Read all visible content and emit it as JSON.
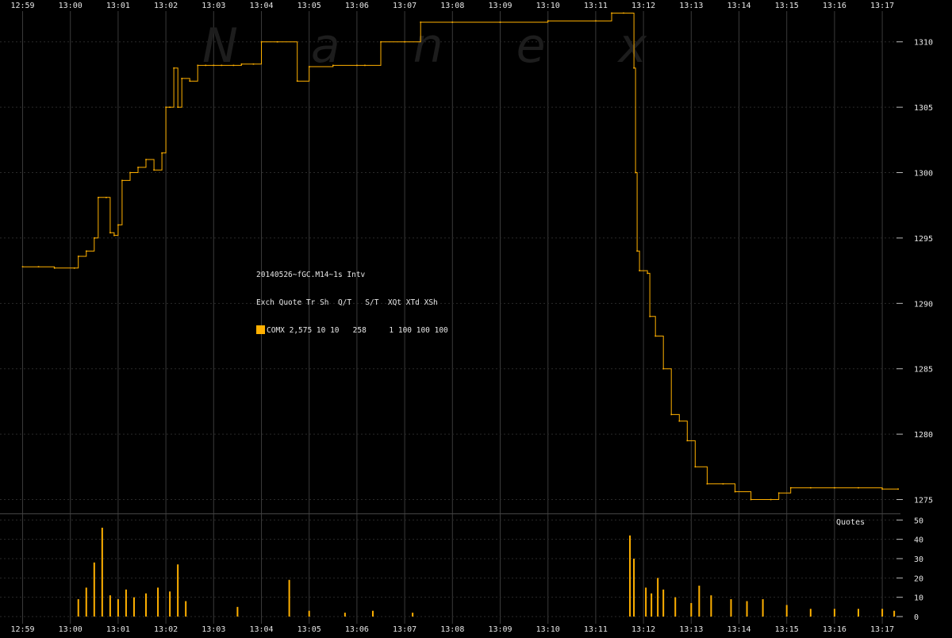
{
  "watermark": "N a n e x",
  "legend": {
    "title": "20140526~fGC.M14~1s Intv",
    "header": "Exch Quote Tr Sh  Q/T   S/T  XQt XTd XSh",
    "row": "COMX 2,575 10 10   258     1 100 100 100",
    "swatch_color": "#ffb000"
  },
  "volume_label": "Quotes",
  "colors": {
    "background": "#000000",
    "price": "#ffb000",
    "volume": "#ffb000",
    "grid": "#333333",
    "text": "#e6e6e6"
  },
  "chart_data": [
    {
      "type": "line",
      "title": "",
      "xlabel": "",
      "ylabel": "",
      "x_ticks": [
        "12:59",
        "13:00",
        "13:01",
        "13:02",
        "13:03",
        "13:04",
        "13:05",
        "13:06",
        "13:07",
        "13:08",
        "13:09",
        "13:10",
        "13:11",
        "13:12",
        "13:13",
        "13:14",
        "13:15",
        "13:16",
        "13:17"
      ],
      "xlim_minutes_after_1259": [
        -0.05,
        18.35
      ],
      "y_ticks": [
        1275,
        1280,
        1285,
        1290,
        1295,
        1300,
        1305,
        1310
      ],
      "ylim": [
        1274,
        1311.5
      ],
      "grid": true,
      "series": [
        {
          "points": [
            [
              "12:59:00",
              1292.8
            ],
            [
              "12:59:20",
              1292.8
            ],
            [
              "12:59:40",
              1292.7
            ],
            [
              "13:00:05",
              1292.7
            ],
            [
              "13:00:10",
              1293.6
            ],
            [
              "13:00:20",
              1294.0
            ],
            [
              "13:00:30",
              1295.0
            ],
            [
              "13:00:35",
              1298.1
            ],
            [
              "13:00:45",
              1298.1
            ],
            [
              "13:00:50",
              1295.4
            ],
            [
              "13:00:55",
              1295.2
            ],
            [
              "13:01:00",
              1296.0
            ],
            [
              "13:01:05",
              1299.4
            ],
            [
              "13:01:15",
              1300.0
            ],
            [
              "13:01:25",
              1300.4
            ],
            [
              "13:01:35",
              1301.0
            ],
            [
              "13:01:45",
              1300.2
            ],
            [
              "13:01:55",
              1301.5
            ],
            [
              "13:02:00",
              1305.0
            ],
            [
              "13:02:05",
              1305.0
            ],
            [
              "13:02:10",
              1308.0
            ],
            [
              "13:02:15",
              1305.0
            ],
            [
              "13:02:20",
              1307.2
            ],
            [
              "13:02:30",
              1307.0
            ],
            [
              "13:02:40",
              1308.2
            ],
            [
              "13:02:50",
              1308.2
            ],
            [
              "13:03:00",
              1308.2
            ],
            [
              "13:03:10",
              1308.2
            ],
            [
              "13:03:25",
              1308.2
            ],
            [
              "13:03:35",
              1308.3
            ],
            [
              "13:03:50",
              1308.3
            ],
            [
              "13:04:00",
              1310.0
            ],
            [
              "13:04:20",
              1310.0
            ],
            [
              "13:04:45",
              1307.0
            ],
            [
              "13:05:00",
              1308.1
            ],
            [
              "13:05:30",
              1308.2
            ],
            [
              "13:06:00",
              1308.2
            ],
            [
              "13:06:10",
              1308.2
            ],
            [
              "13:06:30",
              1310.0
            ],
            [
              "13:07:00",
              1310.0
            ],
            [
              "13:07:20",
              1311.5
            ],
            [
              "13:08:00",
              1311.5
            ],
            [
              "13:09:00",
              1311.5
            ],
            [
              "13:10:00",
              1311.6
            ],
            [
              "13:11:00",
              1311.6
            ],
            [
              "13:11:20",
              1312.2
            ],
            [
              "13:11:35",
              1312.2
            ],
            [
              "13:11:48",
              1308.0
            ],
            [
              "13:11:50",
              1300.0
            ],
            [
              "13:11:52",
              1294.0
            ],
            [
              "13:11:55",
              1292.5
            ],
            [
              "13:12:05",
              1292.3
            ],
            [
              "13:12:08",
              1289.0
            ],
            [
              "13:12:15",
              1287.5
            ],
            [
              "13:12:25",
              1285.0
            ],
            [
              "13:12:35",
              1281.5
            ],
            [
              "13:12:45",
              1281.0
            ],
            [
              "13:12:55",
              1279.5
            ],
            [
              "13:13:05",
              1277.5
            ],
            [
              "13:13:20",
              1276.2
            ],
            [
              "13:13:40",
              1276.2
            ],
            [
              "13:13:55",
              1275.6
            ],
            [
              "13:14:15",
              1275.0
            ],
            [
              "13:14:40",
              1275.0
            ],
            [
              "13:14:50",
              1275.5
            ],
            [
              "13:15:05",
              1275.9
            ],
            [
              "13:15:30",
              1275.9
            ],
            [
              "13:16:00",
              1275.9
            ],
            [
              "13:16:30",
              1275.9
            ],
            [
              "13:17:00",
              1275.8
            ],
            [
              "13:17:20",
              1275.8
            ]
          ]
        }
      ]
    },
    {
      "type": "bar",
      "title": "",
      "ylabel": "",
      "y_ticks": [
        0,
        10,
        20,
        30,
        40,
        50
      ],
      "ylim": [
        0,
        53
      ],
      "bar_width_seconds": 1,
      "bars": [
        [
          "13:00:10",
          9
        ],
        [
          "13:00:20",
          15
        ],
        [
          "13:00:30",
          28
        ],
        [
          "13:00:40",
          46
        ],
        [
          "13:00:50",
          11
        ],
        [
          "13:01:00",
          9
        ],
        [
          "13:01:10",
          14
        ],
        [
          "13:01:20",
          10
        ],
        [
          "13:01:35",
          12
        ],
        [
          "13:01:50",
          15
        ],
        [
          "13:02:05",
          13
        ],
        [
          "13:02:15",
          27
        ],
        [
          "13:02:25",
          8
        ],
        [
          "13:03:30",
          5
        ],
        [
          "13:04:35",
          19
        ],
        [
          "13:05:00",
          3
        ],
        [
          "13:05:45",
          2
        ],
        [
          "13:06:20",
          3
        ],
        [
          "13:07:10",
          2
        ],
        [
          "13:11:43",
          42
        ],
        [
          "13:11:48",
          30
        ],
        [
          "13:12:03",
          15
        ],
        [
          "13:12:10",
          12
        ],
        [
          "13:12:18",
          20
        ],
        [
          "13:12:25",
          14
        ],
        [
          "13:12:40",
          10
        ],
        [
          "13:13:00",
          7
        ],
        [
          "13:13:10",
          16
        ],
        [
          "13:13:25",
          11
        ],
        [
          "13:13:50",
          9
        ],
        [
          "13:14:10",
          8
        ],
        [
          "13:14:30",
          9
        ],
        [
          "13:15:00",
          6
        ],
        [
          "13:15:30",
          4
        ],
        [
          "13:16:00",
          4
        ],
        [
          "13:16:30",
          4
        ],
        [
          "13:17:00",
          4
        ],
        [
          "13:17:15",
          3
        ]
      ]
    }
  ]
}
